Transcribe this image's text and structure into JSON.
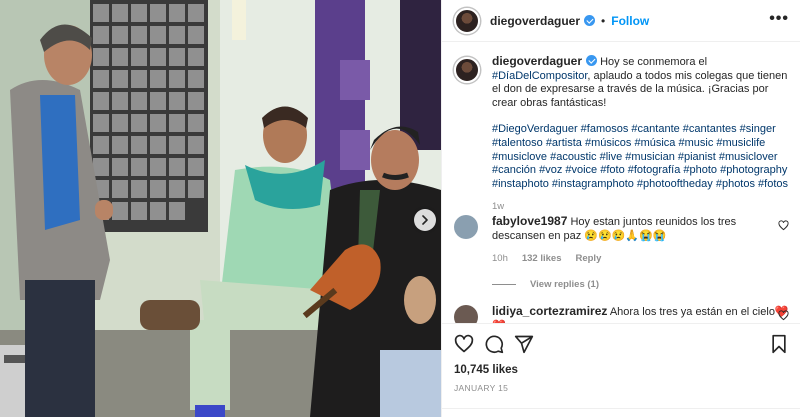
{
  "post": {
    "username": "diegoverdaguer",
    "follow_label": "Follow",
    "more_label": "•••",
    "caption": {
      "username": "diegoverdaguer",
      "text_before": "Hoy se conmemora el ",
      "text_tag": "#DíaDelCompositor",
      "text_after": ", aplaudo a todos mis colegas que tienen el don de expresarse a través de la música. ¡Gracias por crear obras fantásticas!",
      "hashtags": "#DiegoVerdaguer #famosos #cantante #cantantes #singer #talentoso #artista #músicos #música #music #musiclife #musiclove #acoustic #live #musician #pianist #musiclover #canción #voz #voice #foto #fotografía #photo #photography #instaphoto #instagramphoto #photooftheday #photos #fotos",
      "time": "1w"
    },
    "comments": [
      {
        "username": "fabylove1987",
        "text": "Hoy estan juntos reunidos los tres descansen en paz 😢😢😢🙏😭😭",
        "time": "10h",
        "likes": "132 likes",
        "reply_label": "Reply",
        "view_replies": "View replies (1)",
        "avatar_color": "#8a9fb0"
      },
      {
        "username": "lidiya_cortezramirez",
        "text": "Ahora los tres ya están en el cielo❤️❤️",
        "avatar_color": "#6b5a52"
      }
    ],
    "likes_count": "10,745 likes",
    "date": "JANUARY 15"
  },
  "colors": {
    "accent": "#0095f6",
    "hashtag": "#00376b",
    "verified": "#3897f0",
    "muted": "#8e8e8e"
  },
  "icons": [
    "verified-badge-icon",
    "more-options-icon",
    "heart-icon",
    "comment-icon",
    "share-icon",
    "bookmark-icon",
    "carousel-next-icon"
  ]
}
